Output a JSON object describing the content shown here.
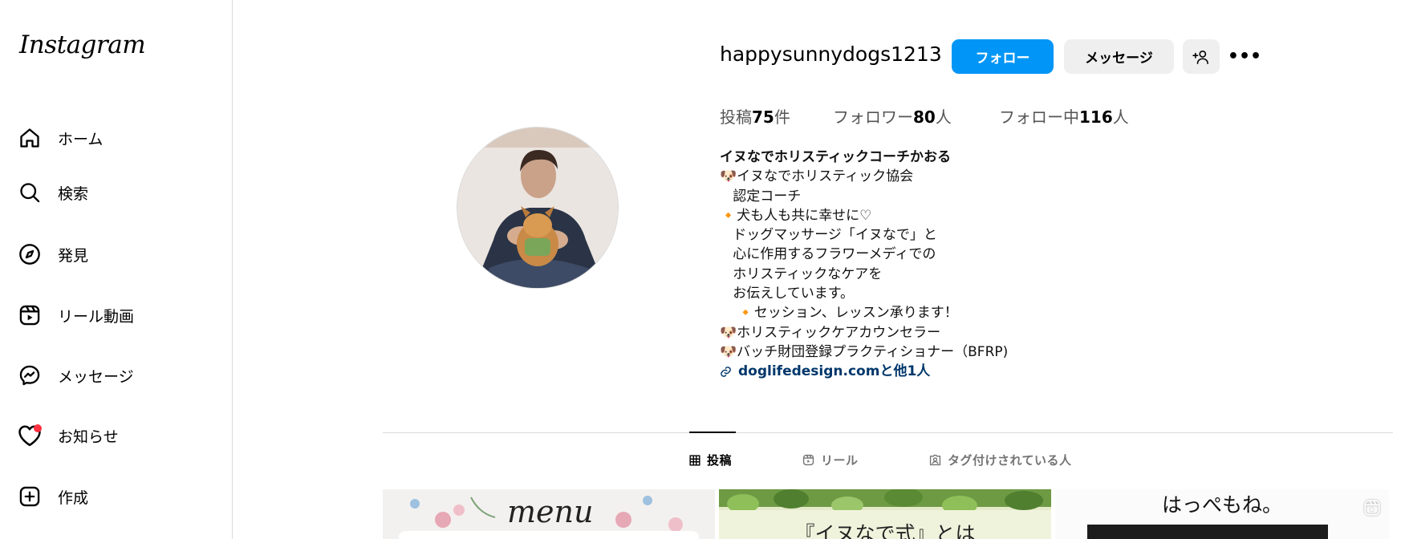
{
  "sidebar": {
    "logo": "Instagram",
    "items": [
      {
        "label": "ホーム",
        "icon": "home-icon"
      },
      {
        "label": "検索",
        "icon": "search-icon"
      },
      {
        "label": "発見",
        "icon": "compass-icon"
      },
      {
        "label": "リール動画",
        "icon": "reels-icon"
      },
      {
        "label": "メッセージ",
        "icon": "messenger-icon"
      },
      {
        "label": "お知らせ",
        "icon": "heart-icon"
      },
      {
        "label": "作成",
        "icon": "plus-square-icon"
      }
    ]
  },
  "profile": {
    "username": "happysunnydogs1213",
    "follow_label": "フォロー",
    "message_label": "メッセージ",
    "more_label": "•••",
    "stats": {
      "posts_prefix": "投稿",
      "posts_count": "75",
      "posts_suffix": "件",
      "followers_prefix": "フォロワー",
      "followers_count": "80",
      "followers_suffix": "人",
      "following_prefix": "フォロー中",
      "following_count": "116",
      "following_suffix": "人"
    },
    "bio": {
      "name": "イヌなでホリスティックコーチかおる",
      "lines": [
        "🐶イヌなでホリスティック協会",
        "   認定コーチ",
        "🔸犬も人も共に幸せに♡",
        "   ドッグマッサージ「イヌなで」と",
        "   心に作用するフラワーメディでの",
        "   ホリスティックなケアを",
        "   お伝えしています。",
        "    🔸セッション、レッスン承ります！",
        "🐶ホリスティックケアカウンセラー",
        "🐶バッチ財団登録プラクティショナー（BFRP)"
      ],
      "link": "doglifedesign.comと他1人"
    }
  },
  "tabs": [
    {
      "label": "投稿",
      "icon": "grid-icon",
      "active": true
    },
    {
      "label": "リール",
      "icon": "reels-icon",
      "active": false
    },
    {
      "label": "タグ付けされている人",
      "icon": "tagged-icon",
      "active": false
    }
  ],
  "grid": {
    "post1_text": "menu",
    "post2_text": "『イヌなで式』とは",
    "post3_text": "はっぺもね。"
  },
  "colors": {
    "follow_button": "#0095f6",
    "secondary_button": "#efefef",
    "link": "#00376b",
    "notification_dot": "#ff3040"
  }
}
